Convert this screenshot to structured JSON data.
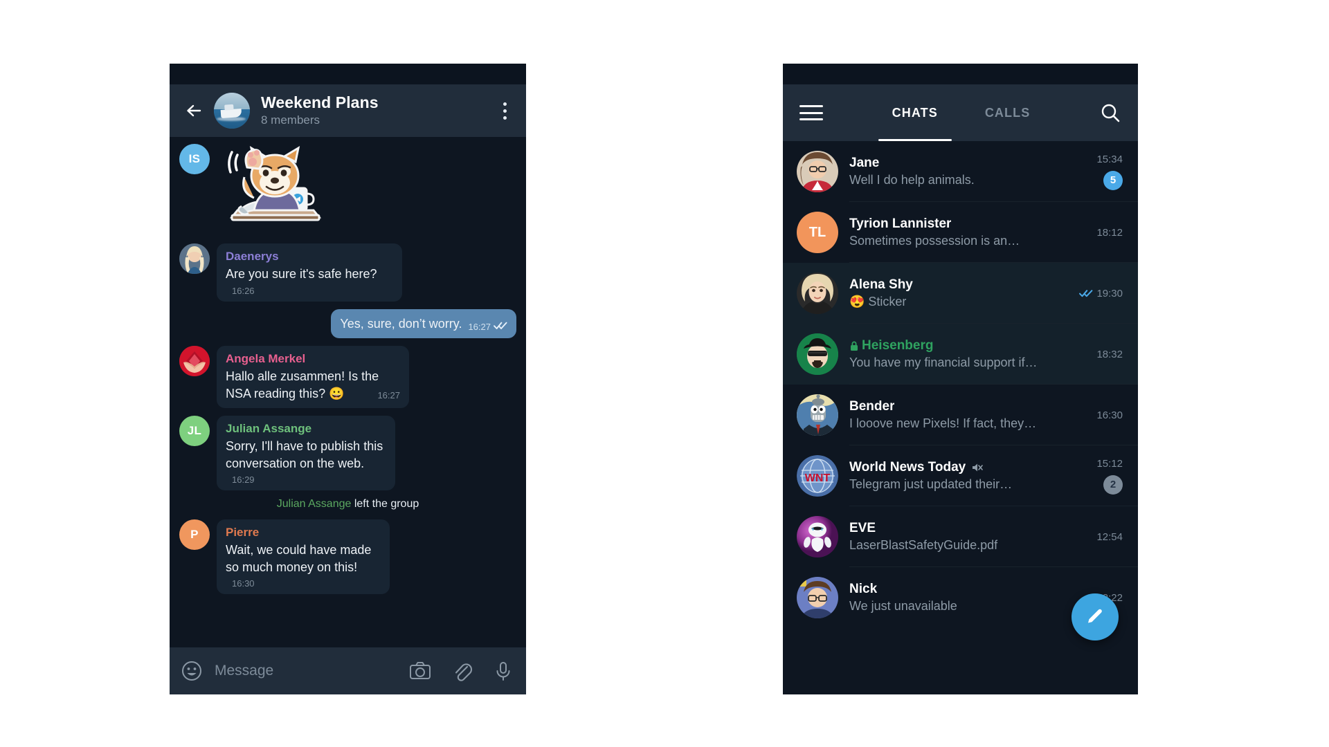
{
  "chat_screen": {
    "appbar": {
      "back_icon": "back-arrow-icon",
      "avatar_icon": "group-photo-avatar",
      "title": "Weekend Plans",
      "subtitle": "8 members",
      "menu_icon": "kebab-menu-icon"
    },
    "messages": [
      {
        "type": "sticker",
        "avatar_initials": "IS",
        "avatar_color": "#63b8e8",
        "sticker_name": "shiba-dog-waving-sticker"
      },
      {
        "type": "incoming",
        "sender": "Daenerys",
        "sender_color": "#8c7fd6",
        "text": "Are you sure it's safe here?",
        "time": "16:26",
        "avatar_name": "daenerys-photo-avatar"
      },
      {
        "type": "outgoing",
        "text": "Yes, sure, don’t worry.",
        "time": "16:27",
        "status_icon": "double-check-icon"
      },
      {
        "type": "incoming",
        "sender": "Angela Merkel",
        "sender_color": "#e8608f",
        "text": "Hallo alle zusammen! Is the NSA reading this? 😀",
        "time": "16:27",
        "avatar_name": "angela-merkel-photo-avatar"
      },
      {
        "type": "incoming",
        "sender": "Julian Assange",
        "sender_color": "#6ec07c",
        "text": "Sorry, I'll have to publish this conversation on the web.",
        "time": "16:29",
        "avatar_initials": "JL",
        "avatar_color": "#7ed07f"
      },
      {
        "type": "service",
        "actor": "Julian Assange",
        "actor_color": "#5ba860",
        "text": " left the group"
      },
      {
        "type": "incoming",
        "sender": "Pierre",
        "sender_color": "#e07a4f",
        "text": "Wait, we could have made so much money on this!",
        "time": "16:30",
        "avatar_initials": "P",
        "avatar_color": "#f0975e"
      }
    ],
    "input_bar": {
      "emoji_icon": "smiley-face-icon",
      "placeholder": "Message",
      "camera_icon": "camera-icon",
      "attach_icon": "paperclip-icon",
      "mic_icon": "microphone-icon"
    }
  },
  "list_screen": {
    "appbar": {
      "menu_icon": "hamburger-menu-icon",
      "tabs": [
        {
          "label": "CHATS",
          "active": true
        },
        {
          "label": "CALLS",
          "active": false
        }
      ],
      "search_icon": "search-icon"
    },
    "chats": [
      {
        "name": "Jane",
        "preview": "Well I do help animals.",
        "time": "15:34",
        "badge": "5",
        "badge_color": "#4aa9e8",
        "selected": false,
        "avatar_name": "jane-photo-avatar"
      },
      {
        "name": "Tyrion Lannister",
        "preview": "Sometimes possession is an…",
        "time": "18:12",
        "badge": "",
        "selected": false,
        "avatar_initials": "TL",
        "avatar_color": "#f2955b"
      },
      {
        "name": "Alena Shy",
        "preview": "😍 Sticker",
        "time": "19:30",
        "badge": "",
        "selected": true,
        "read_icon": "double-check-icon",
        "avatar_name": "alena-shy-photo-avatar"
      },
      {
        "name": "Heisenberg",
        "preview": "You have my financial support if…",
        "time": "18:32",
        "badge": "",
        "selected": true,
        "secret": true,
        "lock_icon": "lock-icon",
        "avatar_name": "heisenberg-photo-avatar"
      },
      {
        "name": "Bender",
        "preview": "I looove new Pixels! If fact, they…",
        "time": "16:30",
        "badge": "",
        "selected": false,
        "avatar_name": "bender-photo-avatar"
      },
      {
        "name": "World News Today",
        "preview": "Telegram just updated their…",
        "time": "15:12",
        "badge": "2",
        "badge_color": "#7d8b99",
        "muted": true,
        "mute_icon": "muted-speaker-icon",
        "selected": false,
        "avatar_name": "world-news-today-logo-avatar"
      },
      {
        "name": "EVE",
        "preview": "LaserBlastSafetyGuide.pdf",
        "time": "12:54",
        "badge": "",
        "selected": false,
        "avatar_name": "eve-robot-photo-avatar"
      },
      {
        "name": "Nick",
        "preview": "We just unavailable",
        "time": "12:22",
        "badge": "",
        "selected": false,
        "avatar_name": "nick-photo-avatar"
      }
    ],
    "fab": {
      "icon": "pencil-compose-icon",
      "color": "#3da5e0"
    }
  },
  "theme": {
    "background": "#0e1621",
    "appbar": "#212d3b",
    "bubble_in": "#182533",
    "bubble_out": "#5a87b0",
    "accent": "#3da5e0",
    "selected_row": "#14212b"
  }
}
